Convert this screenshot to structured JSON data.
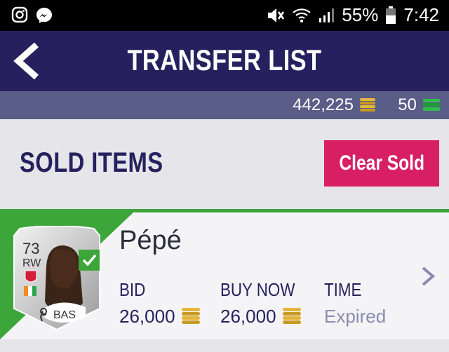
{
  "status_bar": {
    "battery": "55%",
    "time": "7:42",
    "icons": [
      "instagram-icon",
      "messenger-icon",
      "mute-icon",
      "wifi-icon",
      "signal-icon",
      "battery-icon"
    ]
  },
  "header": {
    "title": "TRANSFER LIST",
    "back_icon": "chevron-left-icon"
  },
  "currency": {
    "coins": "442,225",
    "points": "50"
  },
  "section": {
    "title": "SOLD ITEMS",
    "clear_button": "Clear Sold"
  },
  "item": {
    "player": {
      "rating": "73",
      "position": "RW",
      "chemistry_style": "BAS",
      "name": "Pépé"
    },
    "bid_label": "BID",
    "bid_value": "26,000",
    "buy_now_label": "BUY NOW",
    "buy_now_value": "26,000",
    "time_label": "TIME",
    "time_value": "Expired"
  },
  "colors": {
    "nav": "#26215e",
    "currency_bar": "#5a5d87",
    "accent_pink": "#d81f63",
    "sold_green": "#3da63a"
  }
}
